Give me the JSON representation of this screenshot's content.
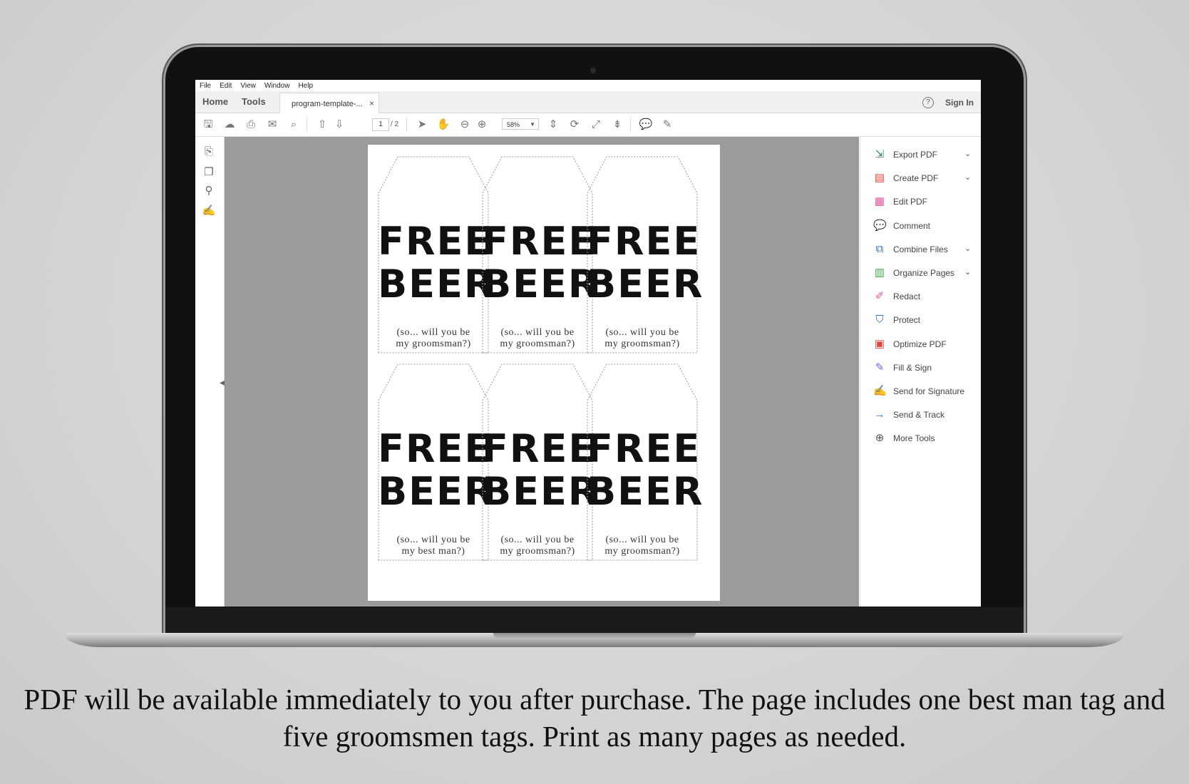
{
  "menu": [
    "File",
    "Edit",
    "View",
    "Window",
    "Help"
  ],
  "tabs": {
    "home": "Home",
    "tools": "Tools",
    "document": "program-template-...",
    "close": "×"
  },
  "header": {
    "help": "?",
    "signin": "Sign In"
  },
  "toolbar": {
    "page_current": "1",
    "page_total": "/ 2",
    "zoom": "58%"
  },
  "tags": [
    {
      "title": "FREE\nBEER",
      "subtitle": "(so... will you be\nmy groomsman?)"
    },
    {
      "title": "FREE\nBEER",
      "subtitle": "(so... will you be\nmy groomsman?)"
    },
    {
      "title": "FREE\nBEER",
      "subtitle": "(so... will you be\nmy groomsman?)"
    },
    {
      "title": "FREE\nBEER",
      "subtitle": "(so... will you be\nmy best man?)"
    },
    {
      "title": "FREE\nBEER",
      "subtitle": "(so... will you be\nmy groomsman?)"
    },
    {
      "title": "FREE\nBEER",
      "subtitle": "(so... will you be\nmy groomsman?)"
    }
  ],
  "tools": [
    {
      "label": "Export PDF",
      "icon": "export-pdf-icon",
      "color": "#2e8b57",
      "expandable": true
    },
    {
      "label": "Create PDF",
      "icon": "create-pdf-icon",
      "color": "#e0453a",
      "expandable": true
    },
    {
      "label": "Edit PDF",
      "icon": "edit-pdf-icon",
      "color": "#e0559a",
      "expandable": false
    },
    {
      "label": "Comment",
      "icon": "comment-icon",
      "color": "#f2b630",
      "expandable": false
    },
    {
      "label": "Combine Files",
      "icon": "combine-files-icon",
      "color": "#2f6fcf",
      "expandable": true
    },
    {
      "label": "Organize Pages",
      "icon": "organize-pages-icon",
      "color": "#3fa34d",
      "expandable": true
    },
    {
      "label": "Redact",
      "icon": "redact-icon",
      "color": "#e0559a",
      "expandable": false
    },
    {
      "label": "Protect",
      "icon": "protect-icon",
      "color": "#2f6fcf",
      "expandable": false
    },
    {
      "label": "Optimize PDF",
      "icon": "optimize-pdf-icon",
      "color": "#e0453a",
      "expandable": false
    },
    {
      "label": "Fill & Sign",
      "icon": "fill-sign-icon",
      "color": "#7b5cd6",
      "expandable": false
    },
    {
      "label": "Send for Signature",
      "icon": "send-signature-icon",
      "color": "#7b5cd6",
      "expandable": false
    },
    {
      "label": "Send & Track",
      "icon": "send-track-icon",
      "color": "#2f6fcf",
      "expandable": false
    },
    {
      "label": "More Tools",
      "icon": "more-tools-icon",
      "color": "#555555",
      "expandable": false
    }
  ],
  "caption": "PDF will be available immediately to you after purchase.  The page includes one best man tag and five groomsmen tags.  Print as many pages as needed."
}
